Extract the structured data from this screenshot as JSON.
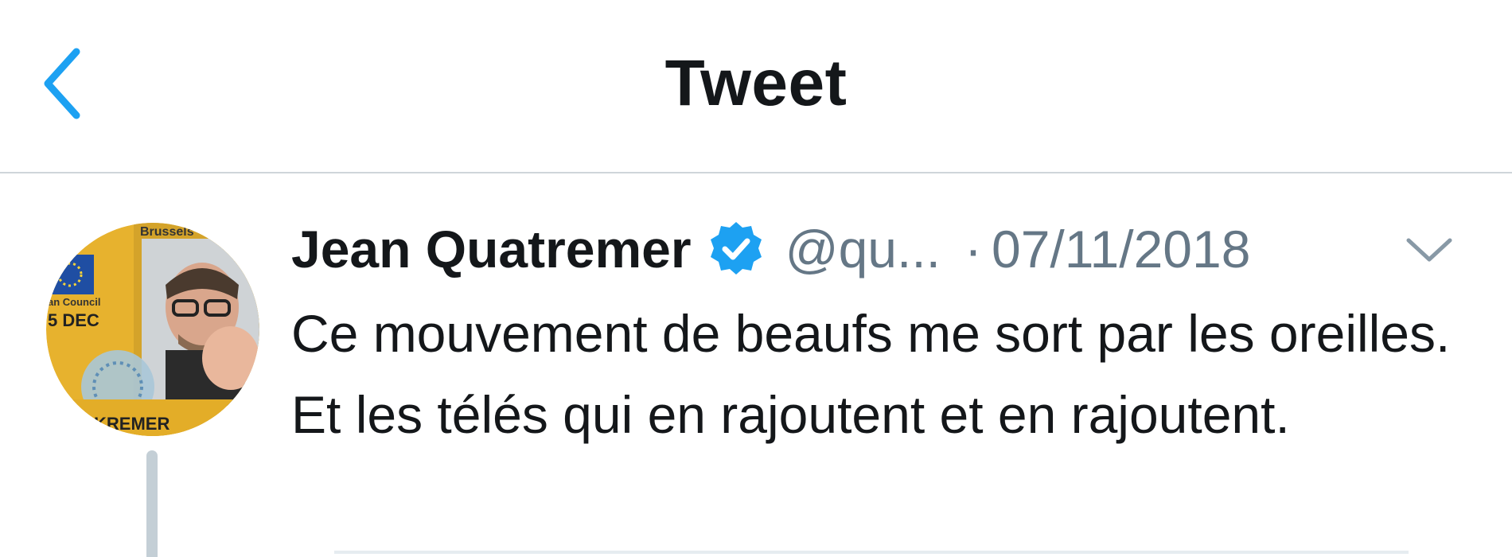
{
  "header": {
    "title": "Tweet",
    "back_icon": "chevron-left-icon",
    "accent_color": "#1da1f2"
  },
  "tweet": {
    "author_name": "Jean Quatremer",
    "verified": true,
    "handle": "@qu...",
    "separator": "·",
    "date": "07/11/2018",
    "text": "Ce mouvement de beaufs me sort par les oreilles. Et les télés qui en rajoutent et en rajoutent.",
    "avatar": {
      "label_top": "Brussels",
      "label_left": "an Council",
      "label_date": "5 DEC",
      "label_bottom": "KREMER"
    }
  }
}
